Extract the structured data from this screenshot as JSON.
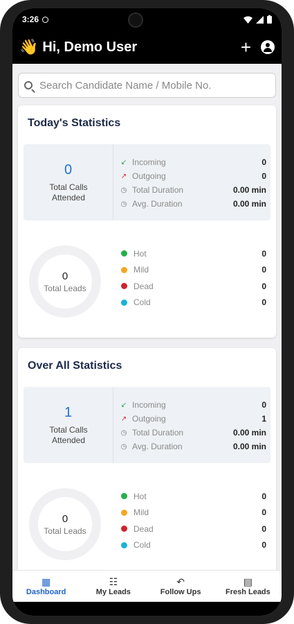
{
  "status_bar": {
    "time": "3:26"
  },
  "app_bar": {
    "greeting": "Hi, Demo User",
    "wave": "👋"
  },
  "search": {
    "placeholder": "Search Candidate Name / Mobile No."
  },
  "today": {
    "title": "Today's Statistics",
    "total_calls": "0",
    "total_calls_label": "Total Calls Attended",
    "call_rows": [
      {
        "label": "Incoming",
        "value": "0",
        "icon": "incoming-call-icon"
      },
      {
        "label": "Outgoing",
        "value": "0",
        "icon": "outgoing-call-icon"
      },
      {
        "label": "Total Duration",
        "value": "0.00 min",
        "icon": "clock-icon"
      },
      {
        "label": "Avg. Duration",
        "value": "0.00 min",
        "icon": "clock-icon"
      }
    ],
    "total_leads": "0",
    "total_leads_label": "Total Leads",
    "lead_rows": [
      {
        "label": "Hot",
        "value": "0",
        "color": "#22b14c"
      },
      {
        "label": "Mild",
        "value": "0",
        "color": "#f5a623"
      },
      {
        "label": "Dead",
        "value": "0",
        "color": "#d0232b"
      },
      {
        "label": "Cold",
        "value": "0",
        "color": "#18b4d6"
      }
    ]
  },
  "overall": {
    "title": "Over All Statistics",
    "total_calls": "1",
    "total_calls_label": "Total Calls Attended",
    "call_rows": [
      {
        "label": "Incoming",
        "value": "0",
        "icon": "incoming-call-icon"
      },
      {
        "label": "Outgoing",
        "value": "1",
        "icon": "outgoing-call-icon"
      },
      {
        "label": "Total Duration",
        "value": "0.00 min",
        "icon": "clock-icon"
      },
      {
        "label": "Avg. Duration",
        "value": "0.00 min",
        "icon": "clock-icon"
      }
    ],
    "total_leads": "0",
    "total_leads_label": "Total Leads",
    "lead_rows": [
      {
        "label": "Hot",
        "value": "0",
        "color": "#22b14c"
      },
      {
        "label": "Mild",
        "value": "0",
        "color": "#f5a623"
      },
      {
        "label": "Dead",
        "value": "0",
        "color": "#d0232b"
      },
      {
        "label": "Cold",
        "value": "0",
        "color": "#18b4d6"
      }
    ]
  },
  "nav": [
    {
      "label": "Dashboard",
      "icon": "grid-icon"
    },
    {
      "label": "My Leads",
      "icon": "checklist-icon"
    },
    {
      "label": "Follow Ups",
      "icon": "reply-all-icon"
    },
    {
      "label": "Fresh Leads",
      "icon": "calendar-icon"
    }
  ],
  "accent_color": "#1e63c8"
}
